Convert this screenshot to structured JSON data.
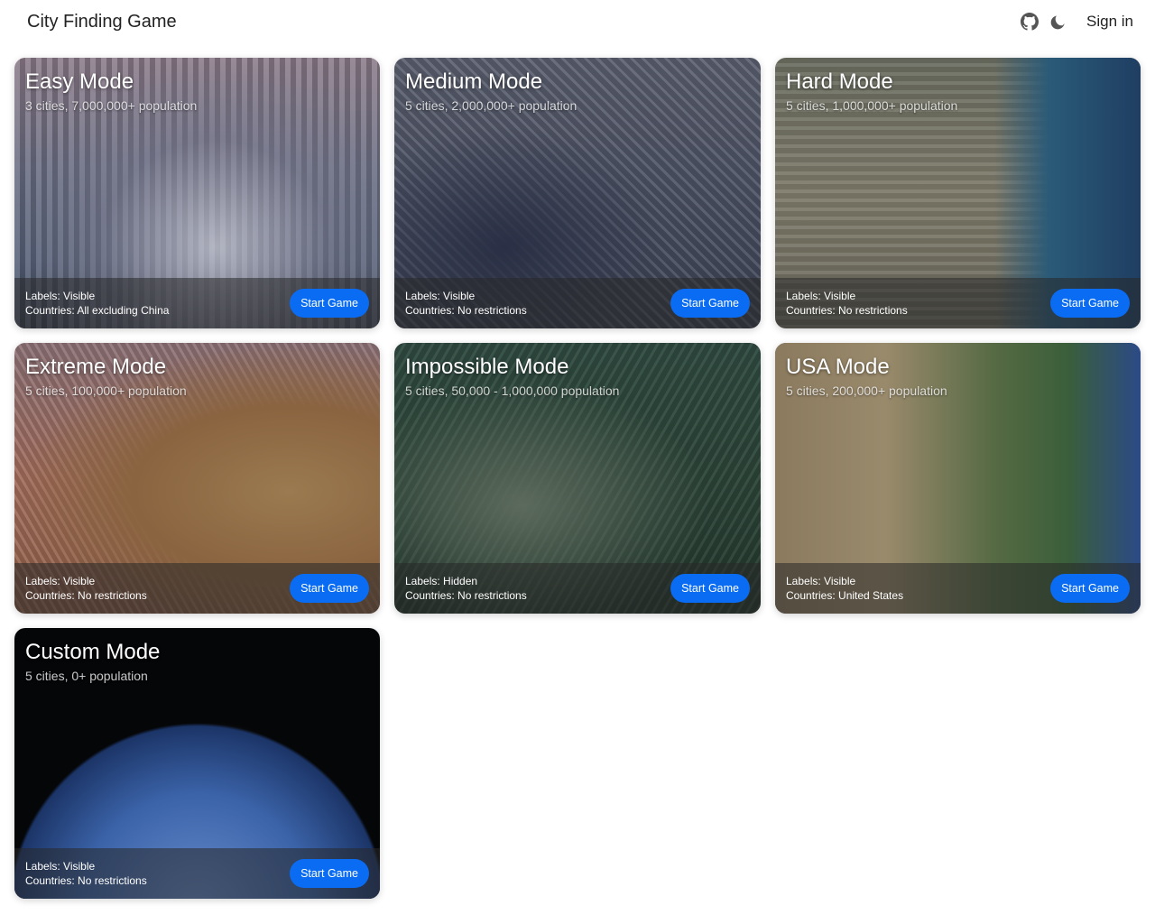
{
  "header": {
    "title": "City Finding Game",
    "title_icon": "",
    "github_icon": "github-icon",
    "theme_icon": "moon-icon",
    "signin_label": "Sign in"
  },
  "modes": [
    {
      "title": "Easy Mode",
      "subtitle": "3 cities, 7,000,000+ population",
      "labels": "Labels: Visible",
      "countries": "Countries: All excluding China",
      "button": "Start Game"
    },
    {
      "title": "Medium Mode",
      "subtitle": "5 cities, 2,000,000+ population",
      "labels": "Labels: Visible",
      "countries": "Countries: No restrictions",
      "button": "Start Game"
    },
    {
      "title": "Hard Mode",
      "subtitle": "5 cities, 1,000,000+ population",
      "labels": "Labels: Visible",
      "countries": "Countries: No restrictions",
      "button": "Start Game"
    },
    {
      "title": "Extreme Mode",
      "subtitle": "5 cities, 100,000+ population",
      "labels": "Labels: Visible",
      "countries": "Countries: No restrictions",
      "button": "Start Game"
    },
    {
      "title": "Impossible Mode",
      "subtitle": "5 cities, 50,000 - 1,000,000 population",
      "labels": "Labels: Hidden",
      "countries": "Countries: No restrictions",
      "button": "Start Game"
    },
    {
      "title": "USA Mode",
      "subtitle": "5 cities, 200,000+ population",
      "labels": "Labels: Visible",
      "countries": "Countries: United States",
      "button": "Start Game"
    },
    {
      "title": "Custom Mode",
      "subtitle": "5 cities, 0+ population",
      "labels": "Labels: Visible",
      "countries": "Countries: No restrictions",
      "button": "Start Game"
    }
  ],
  "colors": {
    "button": "#0a6cf2",
    "footer_overlay": "rgba(40,40,40,0.55)"
  }
}
